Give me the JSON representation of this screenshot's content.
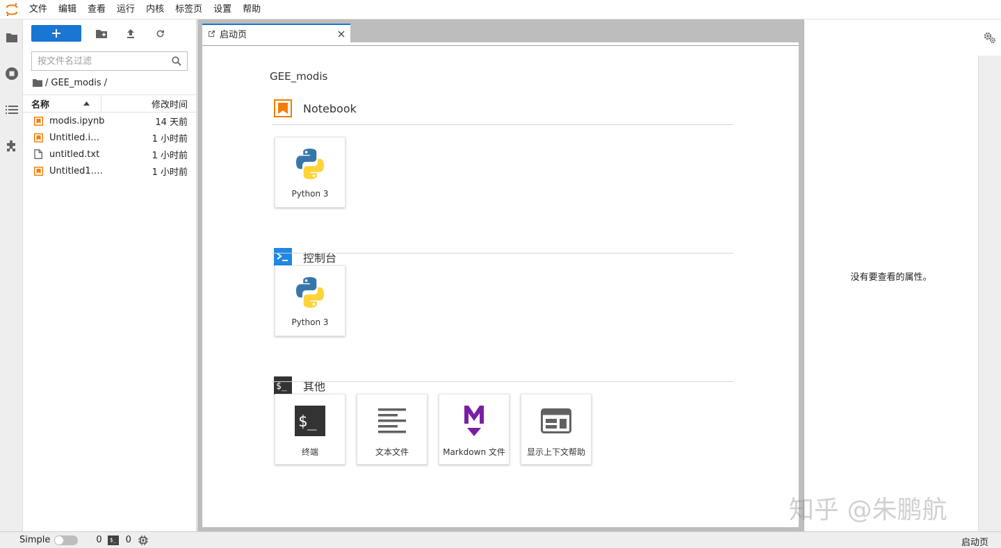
{
  "menubar": {
    "items": [
      "文件",
      "编辑",
      "查看",
      "运行",
      "内核",
      "标签页",
      "设置",
      "帮助"
    ]
  },
  "filebrowser": {
    "search_placeholder": "按文件名过滤",
    "breadcrumb": [
      "/",
      "GEE_modis",
      "/"
    ],
    "columns": {
      "name": "名称",
      "modified": "修改时间"
    },
    "files": [
      {
        "name": "modis.ipynb",
        "modified": "14 天前",
        "type": "notebook"
      },
      {
        "name": "Untitled.ipy...",
        "modified": "1 小时前",
        "type": "notebook"
      },
      {
        "name": "untitled.txt",
        "modified": "1 小时前",
        "type": "text"
      },
      {
        "name": "Untitled1.ip...",
        "modified": "1 小时前",
        "type": "notebook"
      }
    ]
  },
  "tab": {
    "label": "启动页"
  },
  "launcher": {
    "title": "GEE_modis",
    "sections": {
      "notebook": {
        "title": "Notebook",
        "cards": [
          "Python 3"
        ]
      },
      "console": {
        "title": "控制台",
        "cards": [
          "Python 3"
        ]
      },
      "other": {
        "title": "其他",
        "cards": [
          "终端",
          "文本文件",
          "Markdown 文件",
          "显示上下文帮助"
        ]
      }
    }
  },
  "rightpanel": {
    "message": "没有要查看的属性。"
  },
  "watermark": "知乎 @朱鹏航",
  "statusbar": {
    "mode": "Simple",
    "kernels": "0",
    "terminals": "0",
    "terminal_badge": "$_",
    "right": "启动页"
  },
  "colors": {
    "accent": "#1976d2",
    "notebook_orange": "#f57c00",
    "markdown_purple": "#7b1fa2"
  }
}
